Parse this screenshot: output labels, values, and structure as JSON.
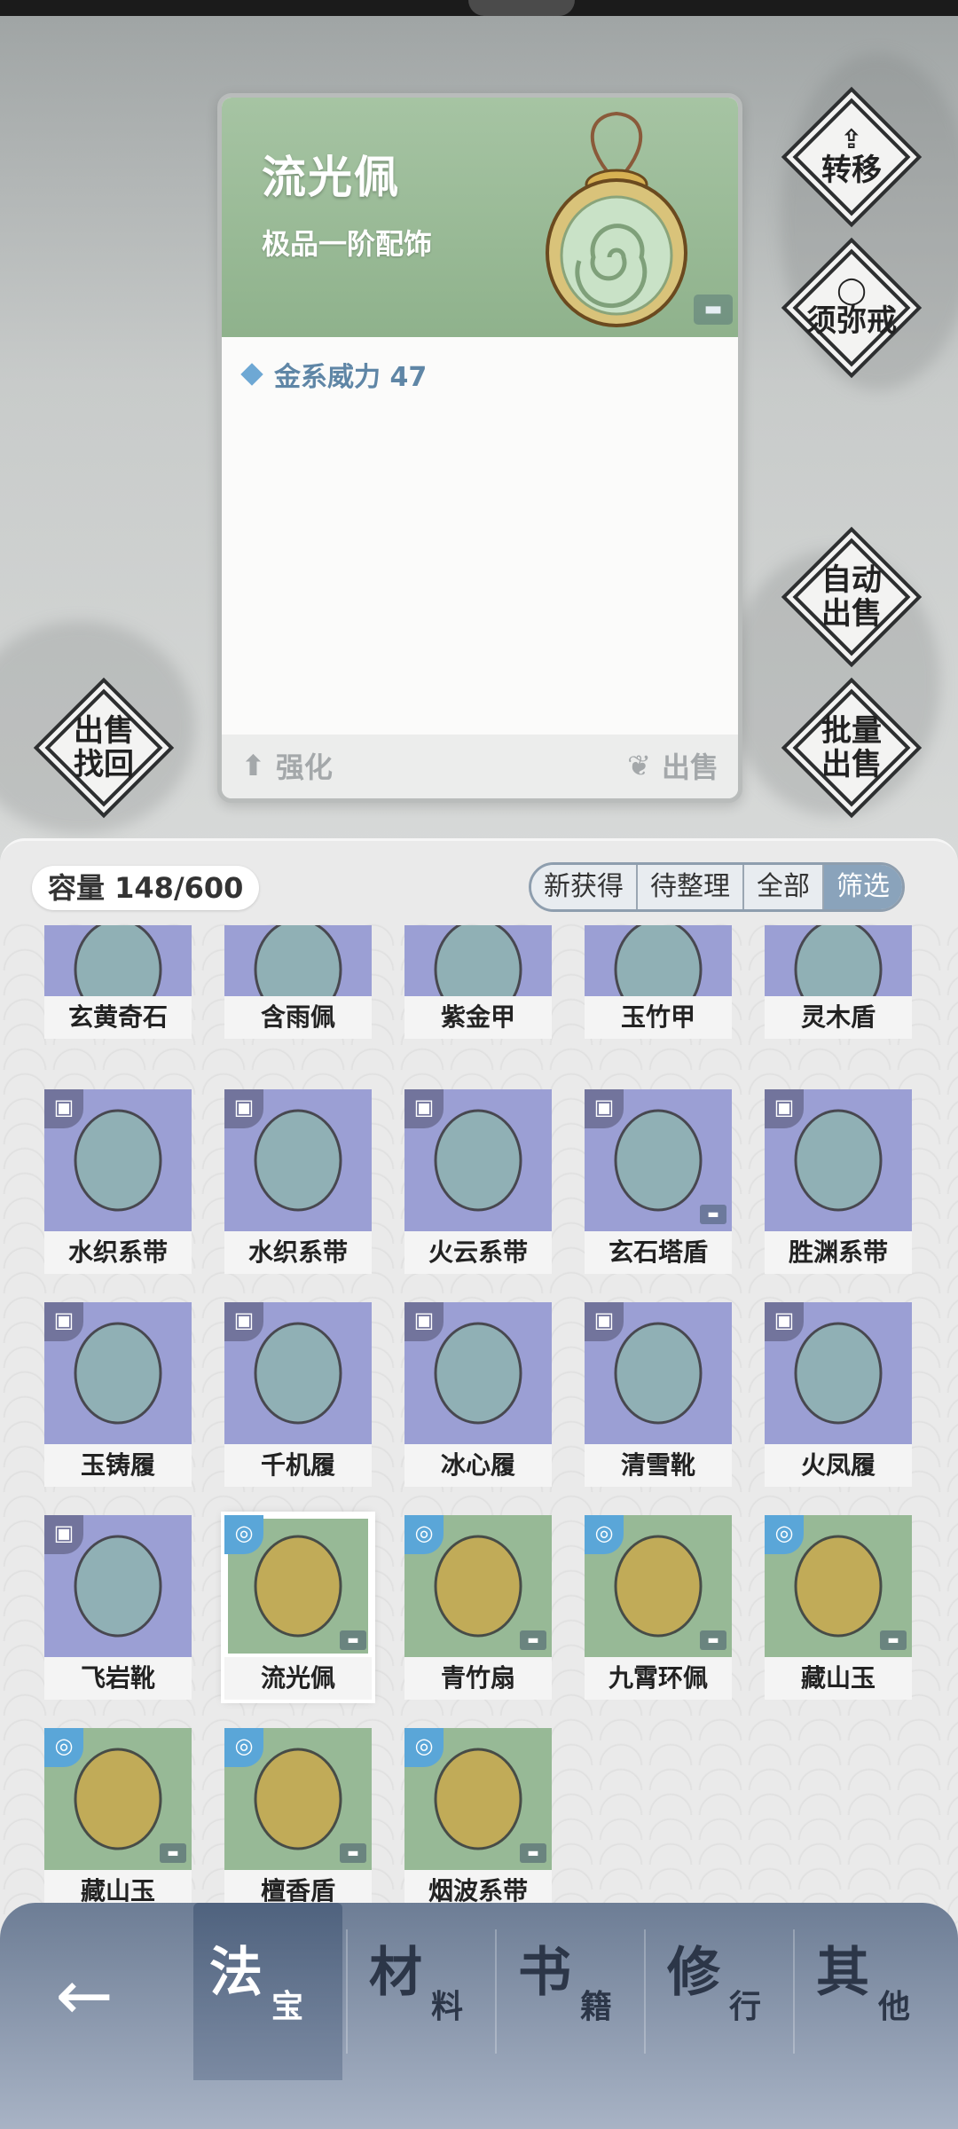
{
  "detail": {
    "name": "流光佩",
    "grade": "极品一阶配饰",
    "stat": "金系威力 47",
    "enhance_label": "强化",
    "sell_label": "出售"
  },
  "side_buttons": {
    "transfer": "转移",
    "sumeru": "须弥戒",
    "auto_sell_1": "自动",
    "auto_sell_2": "出售",
    "batch_sell_1": "批量",
    "batch_sell_2": "出售",
    "recover_1": "出售",
    "recover_2": "找回"
  },
  "inventory": {
    "capacity": "容量 148/600",
    "tabs": [
      "新获得",
      "待整理",
      "全部",
      "筛选"
    ],
    "items": [
      {
        "name": "玄黄奇石",
        "bg": "purple"
      },
      {
        "name": "含雨佩",
        "bg": "purple"
      },
      {
        "name": "紫金甲",
        "bg": "purple"
      },
      {
        "name": "玉竹甲",
        "bg": "purple"
      },
      {
        "name": "灵木盾",
        "bg": "purple"
      },
      {
        "name": "水织系带",
        "bg": "purple"
      },
      {
        "name": "水织系带",
        "bg": "purple"
      },
      {
        "name": "火云系带",
        "bg": "purple"
      },
      {
        "name": "玄石塔盾",
        "bg": "purple"
      },
      {
        "name": "胜渊系带",
        "bg": "purple"
      },
      {
        "name": "玉铸履",
        "bg": "purple"
      },
      {
        "name": "千机履",
        "bg": "purple"
      },
      {
        "name": "冰心履",
        "bg": "purple"
      },
      {
        "name": "清雪靴",
        "bg": "purple"
      },
      {
        "name": "火凤履",
        "bg": "purple"
      },
      {
        "name": "飞岩靴",
        "bg": "purple"
      },
      {
        "name": "流光佩",
        "bg": "green"
      },
      {
        "name": "青竹扇",
        "bg": "green"
      },
      {
        "name": "九霄环佩",
        "bg": "green"
      },
      {
        "name": "藏山玉",
        "bg": "green"
      },
      {
        "name": "藏山玉",
        "bg": "green"
      },
      {
        "name": "檀香盾",
        "bg": "green"
      },
      {
        "name": "烟波系带",
        "bg": "green"
      }
    ]
  },
  "nav": {
    "back_icon": "arrow-left-icon",
    "tabs": [
      {
        "big": "法",
        "small": "宝"
      },
      {
        "big": "材",
        "small": "料"
      },
      {
        "big": "书",
        "small": "籍"
      },
      {
        "big": "修",
        "small": "行"
      },
      {
        "big": "其",
        "small": "他"
      }
    ]
  },
  "colors": {
    "purple_bg": "#9b9fd4",
    "green_bg": "#97b996",
    "nav_active": "#4f627e",
    "stat_text": "#5f86a6"
  }
}
